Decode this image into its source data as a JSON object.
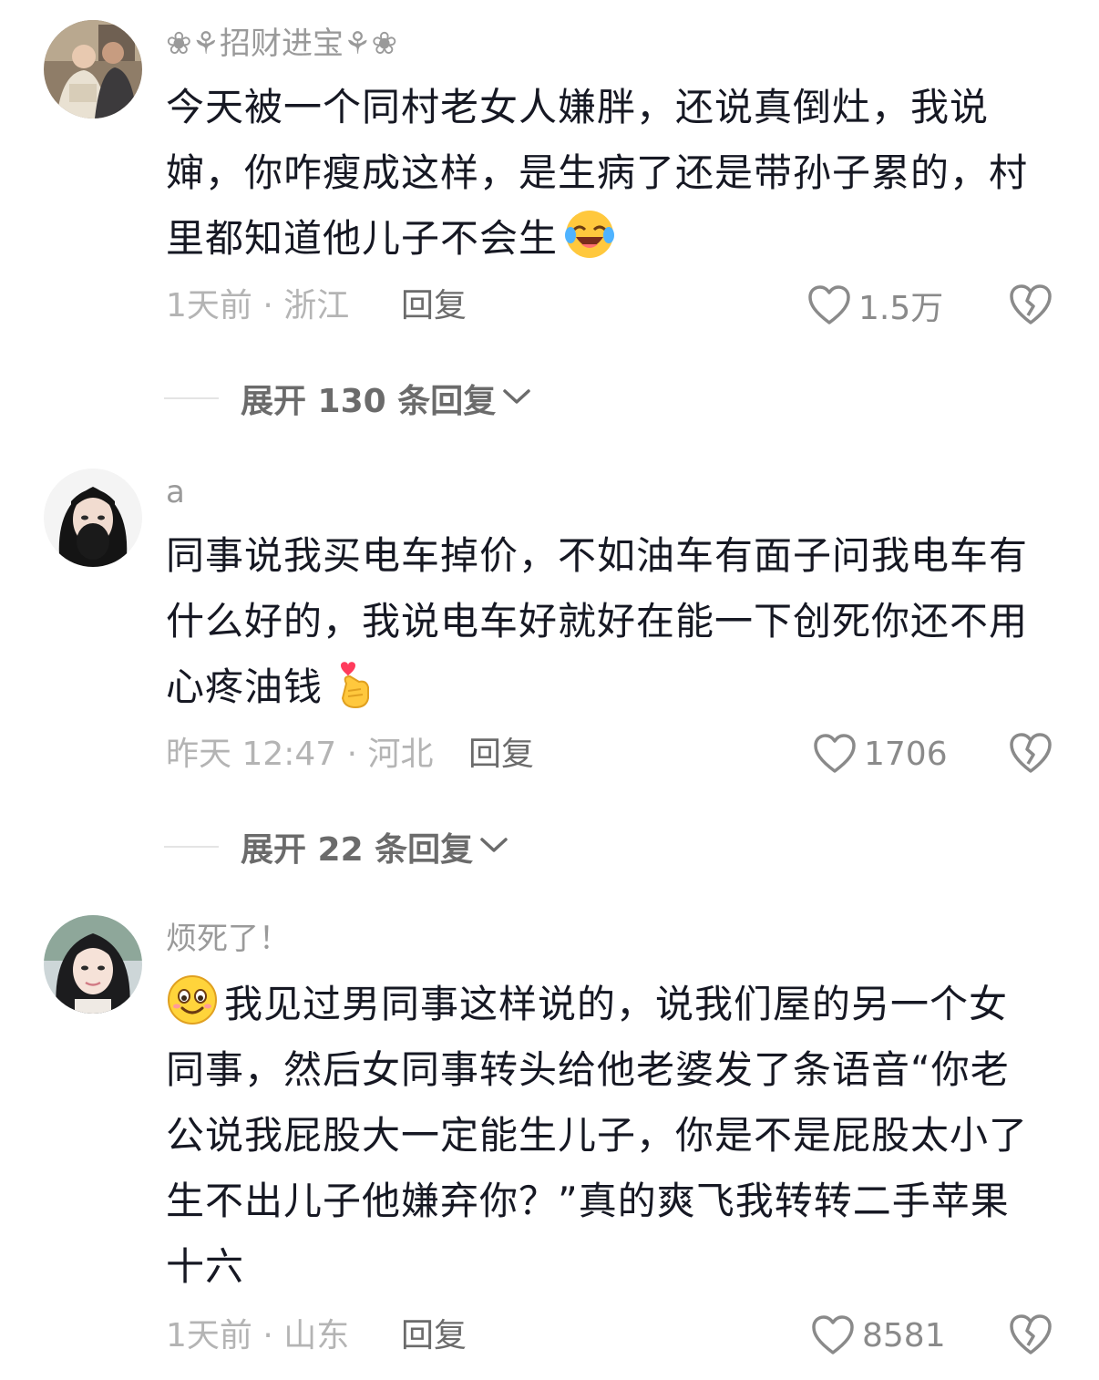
{
  "comments": [
    {
      "username": "❀⚘招财进宝⚘❀",
      "lines": [
        "今天被一个同村老女人嫌胖，还说真倒灶，我说",
        "婶，你咋瘦成这样，是生病了还是带孙子累的，村",
        "里都知道他儿子不会生"
      ],
      "trailing_emoji": "laughing-crying-emoji",
      "time": "1天前",
      "location": "浙江",
      "meta": "1天前 · 浙江",
      "reply_label": "回复",
      "like_count": "1.5万",
      "expand_label": "展开 130 条回复"
    },
    {
      "username": "a",
      "lines": [
        "同事说我买电车掉价，不如油车有面子问我电车有",
        "什么好的，我说电车好就好在能一下创死你还不用",
        "心疼油钱"
      ],
      "trailing_emoji": "finger-heart-emoji",
      "time": "昨天 12:47",
      "location": "河北",
      "meta": "昨天 12:47 · 河北",
      "reply_label": "回复",
      "like_count": "1706",
      "expand_label": "展开 22 条回复"
    },
    {
      "username": "烦死了！",
      "leading_emoji": "smile-emoji",
      "lines": [
        "我见过男同事这样说的，说我们屋的另一个女",
        "同事，然后女同事转头给他老婆发了条语音“你老",
        "公说我屁股大一定能生儿子，你是不是屁股太小了",
        "生不出儿子他嫌弃你？”真的爽飞我转转二手苹果",
        "十六"
      ],
      "time": "1天前",
      "location": "山东",
      "meta": "1天前 · 山东",
      "reply_label": "回复",
      "like_count": "8581"
    }
  ],
  "colors": {
    "text": "#161823",
    "secondary": "#9a9a9a",
    "meta": "#b4b4b4",
    "action": "#6b6b6b"
  }
}
